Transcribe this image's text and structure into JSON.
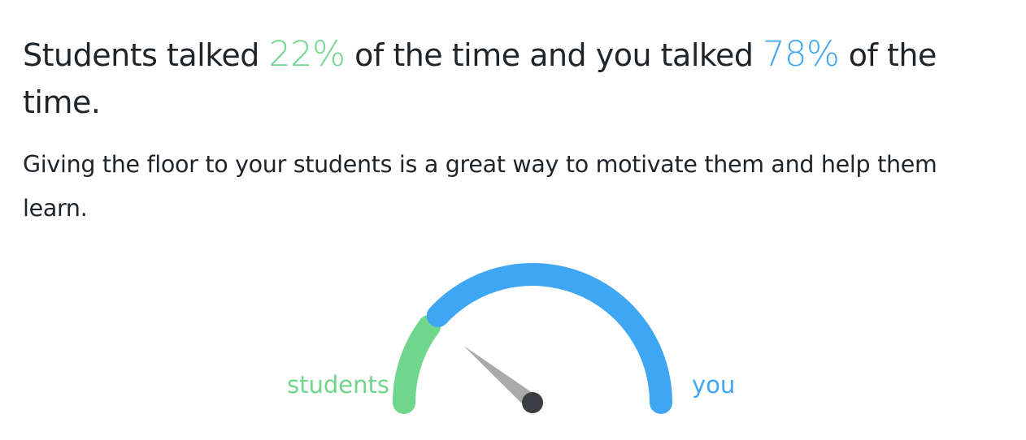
{
  "summary": {
    "prefix": "Students talked ",
    "students_pct_text": "22%",
    "middle": " of the time and you talked ",
    "you_pct_text": "78%",
    "suffix": " of the time."
  },
  "subtext": "Giving the floor to your students is a great way to motivate them and help them learn.",
  "chart_data": {
    "type": "gauge",
    "series": [
      {
        "name": "students",
        "value": 22,
        "color": "#6fd68b"
      },
      {
        "name": "you",
        "value": 78,
        "color": "#3fa6f3"
      }
    ],
    "range": [
      0,
      100
    ],
    "needle_value": 22,
    "needle_color": "#aaaaaa",
    "hub_color": "#3a3d42"
  }
}
